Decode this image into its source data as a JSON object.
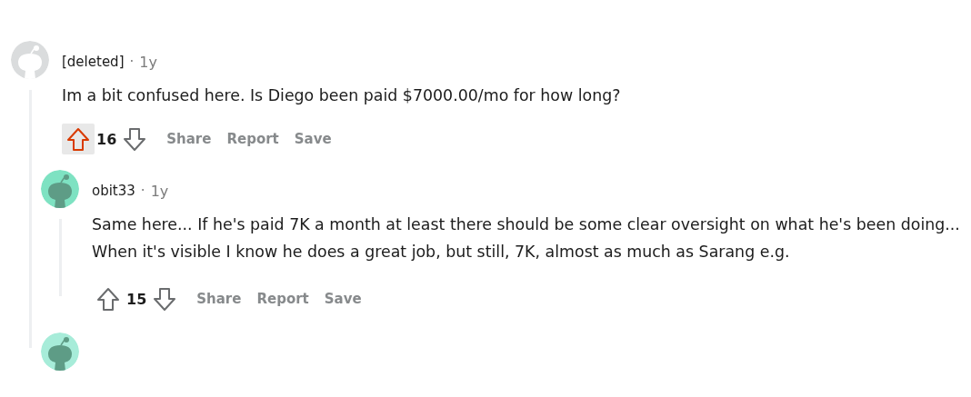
{
  "comments": [
    {
      "author": "[deleted]",
      "separator": "·",
      "age": "1y",
      "color": "#dadcdd",
      "body": "Im a bit confused here. Is Diego been paid $7000.00/mo for how long?",
      "upvoted": true,
      "score": "16",
      "actions": [
        "Share",
        "Report",
        "Save"
      ],
      "children": [
        {
          "author": "obit33",
          "separator": "·",
          "age": "1y",
          "color": "#7ee2c2",
          "body": "Same here... If he's paid 7K a month at least there should be some clear oversight on what he's been doing... When it's visible I know he does a great job, but still, 7K, almost as much as Sarang e.g.",
          "upvoted": false,
          "score": "15",
          "actions": [
            "Share",
            "Report",
            "Save"
          ]
        },
        {
          "color": "#a7ecd9"
        }
      ]
    }
  ]
}
